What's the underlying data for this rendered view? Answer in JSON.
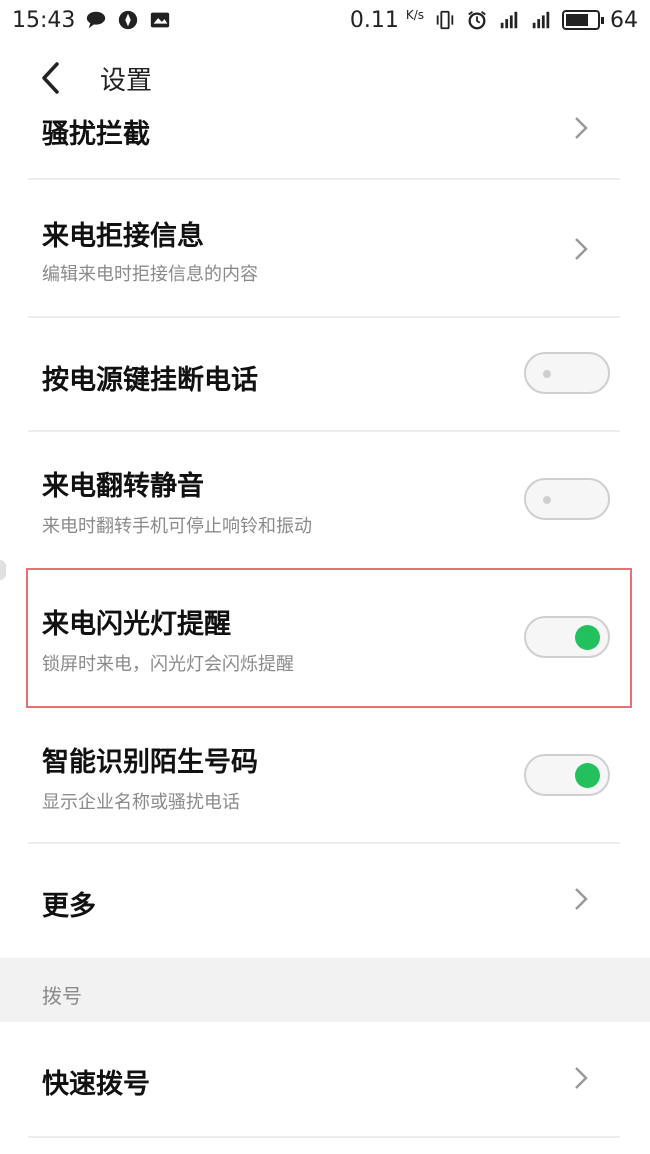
{
  "status_bar": {
    "time": "15:43",
    "speed": "0.11",
    "speed_unit": "K/s",
    "battery": "64"
  },
  "header": {
    "title": "设置"
  },
  "rows": {
    "harassment": {
      "title": "骚扰拦截"
    },
    "reject_message": {
      "title": "来电拒接信息",
      "subtitle": "编辑来电时拒接信息的内容"
    },
    "power_key_hangup": {
      "title": "按电源键挂断电话",
      "enabled": false
    },
    "flip_mute": {
      "title": "来电翻转静音",
      "subtitle": "来电时翻转手机可停止响铃和振动",
      "enabled": false
    },
    "flash_alert": {
      "title": "来电闪光灯提醒",
      "subtitle": "锁屏时来电，闪光灯会闪烁提醒",
      "enabled": true
    },
    "smart_id": {
      "title": "智能识别陌生号码",
      "subtitle": "显示企业名称或骚扰电话",
      "enabled": true
    },
    "more": {
      "title": "更多"
    }
  },
  "section": {
    "dial_label": "拨号"
  },
  "dial_rows": {
    "speed_dial": {
      "title": "快速拨号"
    }
  },
  "colors": {
    "toggle_on": "#22c15e",
    "highlight_border": "#e57373"
  }
}
